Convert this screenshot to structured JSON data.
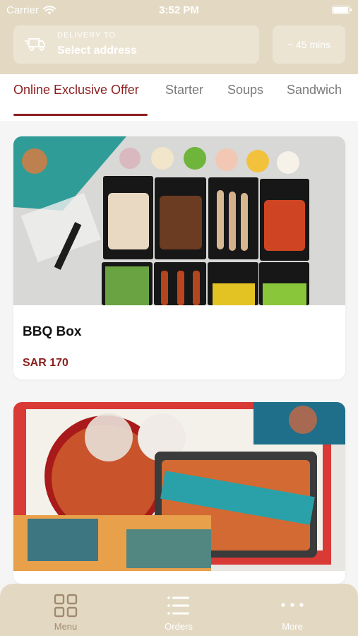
{
  "status_bar": {
    "carrier": "Carrier",
    "time": "3:52 PM"
  },
  "header": {
    "delivery_label": "DELIVERY TO",
    "address": "Select address",
    "eta": "~ 45 mins"
  },
  "tabs": [
    {
      "label": "Online Exclusive Offer",
      "active": true
    },
    {
      "label": "Starter",
      "active": false
    },
    {
      "label": "Soups",
      "active": false
    },
    {
      "label": "Sandwich",
      "active": false
    }
  ],
  "products": [
    {
      "name": "BBQ Box",
      "price": "SAR 170"
    },
    {
      "name": "",
      "price": ""
    }
  ],
  "bottom_nav": [
    {
      "label": "Menu",
      "icon": "grid-icon",
      "active": true
    },
    {
      "label": "Orders",
      "icon": "list-icon",
      "active": false
    },
    {
      "label": "More",
      "icon": "more-dots-icon",
      "active": false
    }
  ],
  "colors": {
    "accent": "#8b1f1f",
    "header_bg": "#e3d9c3",
    "nav_active": "#a08a70",
    "nav_inactive": "#ffffff"
  }
}
